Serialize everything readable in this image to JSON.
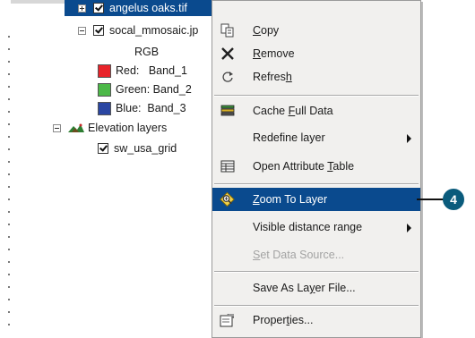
{
  "tree": {
    "selected_layer": "angelus oaks.tif",
    "mosaic_layer": "socal_mmosaic.jp",
    "rgb_label": "RGB",
    "bands": [
      {
        "label": "Red:   Band_1",
        "color": "#e8232a"
      },
      {
        "label": "Green: Band_2",
        "color": "#4cb848"
      },
      {
        "label": "Blue:  Band_3",
        "color": "#2a46a2"
      }
    ],
    "group_layer": "Elevation layers",
    "grid_layer": "sw_usa_grid"
  },
  "menu": {
    "items": [
      {
        "pre": "",
        "ul": "C",
        "post": "opy"
      },
      {
        "pre": "",
        "ul": "R",
        "post": "emove"
      },
      {
        "pre": "Refres",
        "ul": "h",
        "post": ""
      },
      {
        "pre": "Cache ",
        "ul": "F",
        "post": "ull Data"
      },
      {
        "pre": "Redefine layer",
        "ul": "",
        "post": ""
      },
      {
        "pre": "Open Attribute ",
        "ul": "T",
        "post": "able"
      },
      {
        "pre": "",
        "ul": "Z",
        "post": "oom To Layer"
      },
      {
        "pre": "Visible distance range",
        "ul": "",
        "post": ""
      },
      {
        "pre": "",
        "ul": "S",
        "post": "et Data Source..."
      },
      {
        "pre": "Save As La",
        "ul": "y",
        "post": "er File..."
      },
      {
        "pre": "Proper",
        "ul": "t",
        "post": "ies..."
      }
    ]
  },
  "callout": {
    "number": "4"
  },
  "colors": {
    "selection": "#0a4a8e",
    "callout": "#0a5b7c"
  }
}
